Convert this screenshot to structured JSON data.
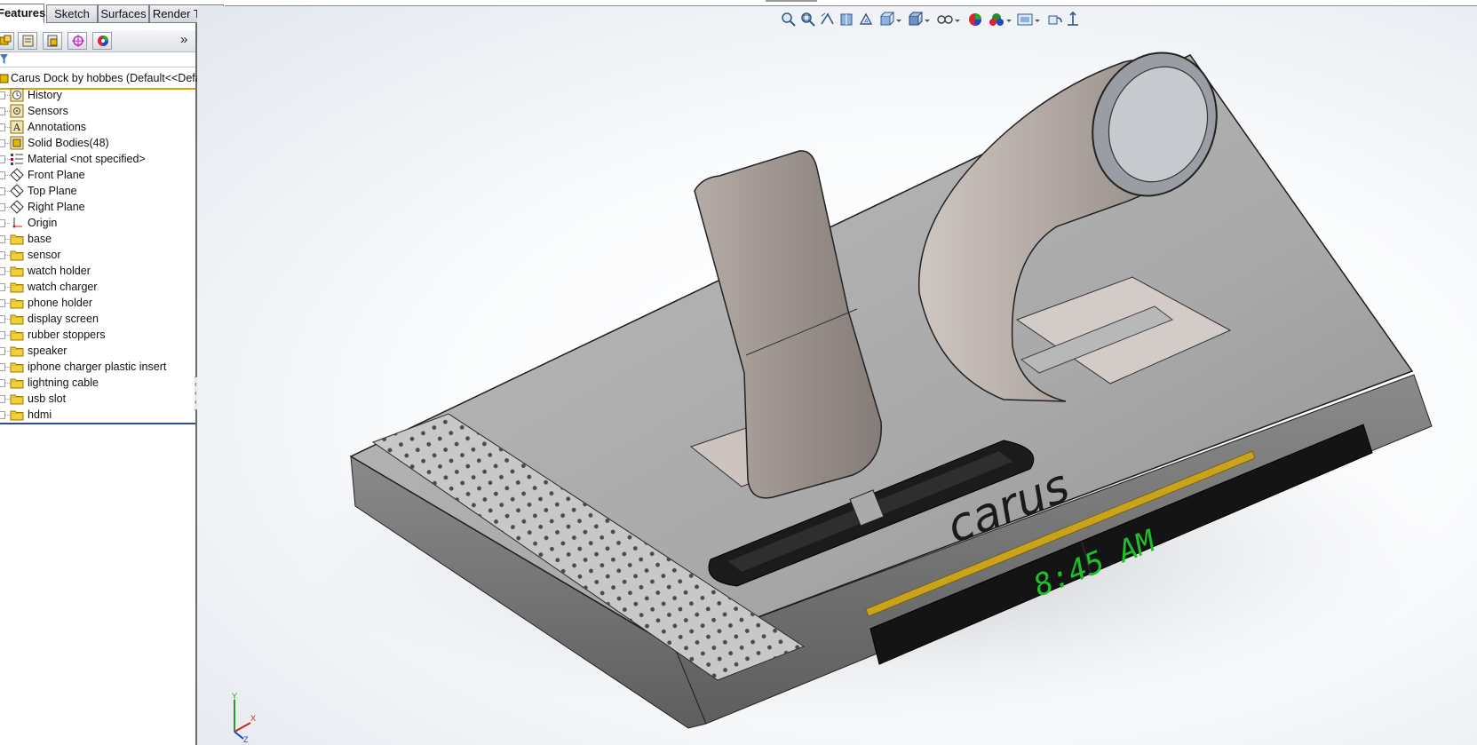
{
  "tabs": [
    {
      "label": "Features",
      "active": true
    },
    {
      "label": "Sketch",
      "active": false
    },
    {
      "label": "Surfaces",
      "active": false
    },
    {
      "label": "Render Tools",
      "active": false
    }
  ],
  "panel_toolbar": {
    "buttons": [
      "feature-manager-icon",
      "property-manager-icon",
      "configuration-manager-icon",
      "dimxpert-manager-icon",
      "display-manager-icon"
    ],
    "more": "»"
  },
  "tree": {
    "root": "Carus Dock by hobbes  (Default<<Defau",
    "items": [
      {
        "label": "History",
        "icon": "history-icon"
      },
      {
        "label": "Sensors",
        "icon": "sensors-icon"
      },
      {
        "label": "Annotations",
        "icon": "annotations-icon"
      },
      {
        "label": "Solid Bodies(48)",
        "icon": "solid-bodies-icon"
      },
      {
        "label": "Material <not specified>",
        "icon": "material-icon"
      },
      {
        "label": "Front Plane",
        "icon": "plane-icon"
      },
      {
        "label": "Top Plane",
        "icon": "plane-icon"
      },
      {
        "label": "Right Plane",
        "icon": "plane-icon"
      },
      {
        "label": "Origin",
        "icon": "origin-icon"
      },
      {
        "label": "base",
        "icon": "folder-icon"
      },
      {
        "label": "sensor",
        "icon": "folder-icon"
      },
      {
        "label": "watch holder",
        "icon": "folder-icon"
      },
      {
        "label": "watch charger",
        "icon": "folder-icon"
      },
      {
        "label": "phone holder",
        "icon": "folder-icon"
      },
      {
        "label": "display screen",
        "icon": "folder-icon"
      },
      {
        "label": "rubber stoppers",
        "icon": "folder-icon"
      },
      {
        "label": "speaker",
        "icon": "folder-icon"
      },
      {
        "label": "iphone charger plastic insert",
        "icon": "folder-icon"
      },
      {
        "label": "lightning cable",
        "icon": "folder-icon"
      },
      {
        "label": "usb slot",
        "icon": "folder-icon"
      },
      {
        "label": "hdmi",
        "icon": "folder-icon"
      }
    ]
  },
  "heads_up_toolbar": [
    "zoom-to-fit-icon",
    "zoom-to-area-icon",
    "previous-view-icon",
    "section-view-icon",
    "dynamic-annotation-icon",
    "view-orientation-icon",
    "display-style-icon",
    "hide-show-items-icon",
    "edit-appearance-icon",
    "apply-scene-icon",
    "view-settings-icon",
    "rotate-icon",
    "normal-to-icon"
  ],
  "model": {
    "brand_text": "carus",
    "clock_text": "8:45 AM",
    "clock_color": "#1fbe2a",
    "accent_strip_color": "#c9a31a"
  },
  "triad": {
    "x": "X",
    "y": "Y",
    "z": "Z"
  }
}
